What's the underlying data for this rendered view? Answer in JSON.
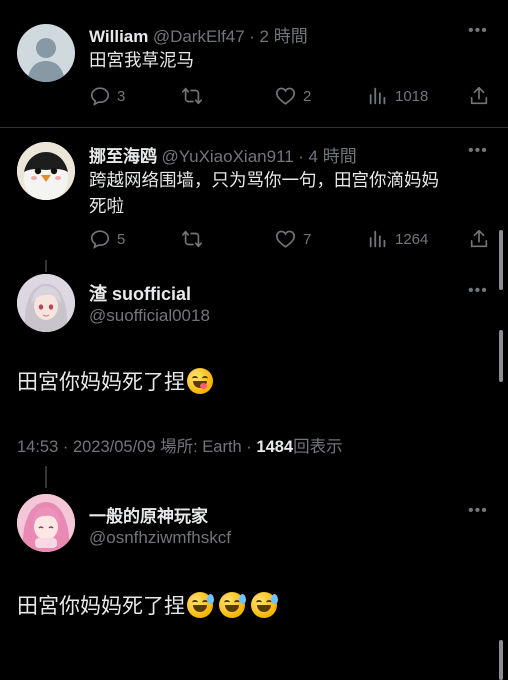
{
  "tweets": [
    {
      "display_name": "William",
      "handle": "@DarkElf47",
      "time": "· 2 時間",
      "text": "田宮我草泥马",
      "replies": "3",
      "likes": "2",
      "views": "1018"
    },
    {
      "display_name": "挪至海鸥",
      "handle": "@YuXiaoXian911",
      "time": "· 4 時間",
      "text_line1": "跨越网络围墙，只为骂你一句，田宫你滴妈妈",
      "text_line2": "死啦",
      "replies": "5",
      "likes": "7",
      "views": "1264"
    }
  ],
  "main_tweet": {
    "display_name": "渣 suofficial",
    "handle": "@suofficial0018",
    "text": "田宮你妈妈死了捏",
    "timestamp": "14:53 · 2023/05/09 場所: Earth · ",
    "view_count": "1484",
    "view_label": "回表示"
  },
  "reply": {
    "display_name": "一般的原神玩家",
    "handle": "@osnfhziwmfhskcf",
    "text": "田宮你妈妈死了捏"
  },
  "icons": {
    "reply": "reply-icon",
    "retweet": "retweet-icon",
    "like": "heart-icon",
    "views": "analytics-icon",
    "share": "share-icon",
    "more": "more-icon"
  },
  "colors": {
    "background": "#000000",
    "text": "#e7e9ea",
    "muted": "#71767b",
    "divider": "#2f3336"
  }
}
